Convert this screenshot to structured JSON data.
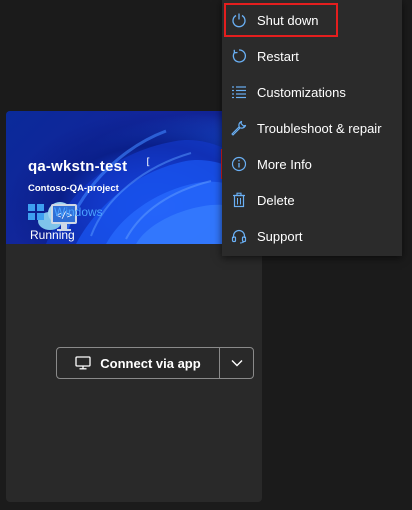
{
  "menu": {
    "items": [
      {
        "label": "Shut down",
        "icon": "power-icon"
      },
      {
        "label": "Restart",
        "icon": "restart-icon"
      },
      {
        "label": "Customizations",
        "icon": "list-icon"
      },
      {
        "label": "Troubleshoot & repair",
        "icon": "wrench-icon"
      },
      {
        "label": "More Info",
        "icon": "info-icon"
      },
      {
        "label": "Delete",
        "icon": "trash-icon"
      },
      {
        "label": "Support",
        "icon": "headset-icon"
      }
    ],
    "highlighted_item": "Shut down"
  },
  "card": {
    "name": "qa-wkstn-test",
    "project": "Contoso-QA-project",
    "os": "Windows",
    "status": "Running",
    "connect_label": "Connect via app"
  },
  "colors": {
    "background": "#1b1b1b",
    "card": "#292929",
    "menu": "#2b2b2b",
    "link_blue": "#4aa3ff",
    "highlight_red": "#e41e1e"
  }
}
